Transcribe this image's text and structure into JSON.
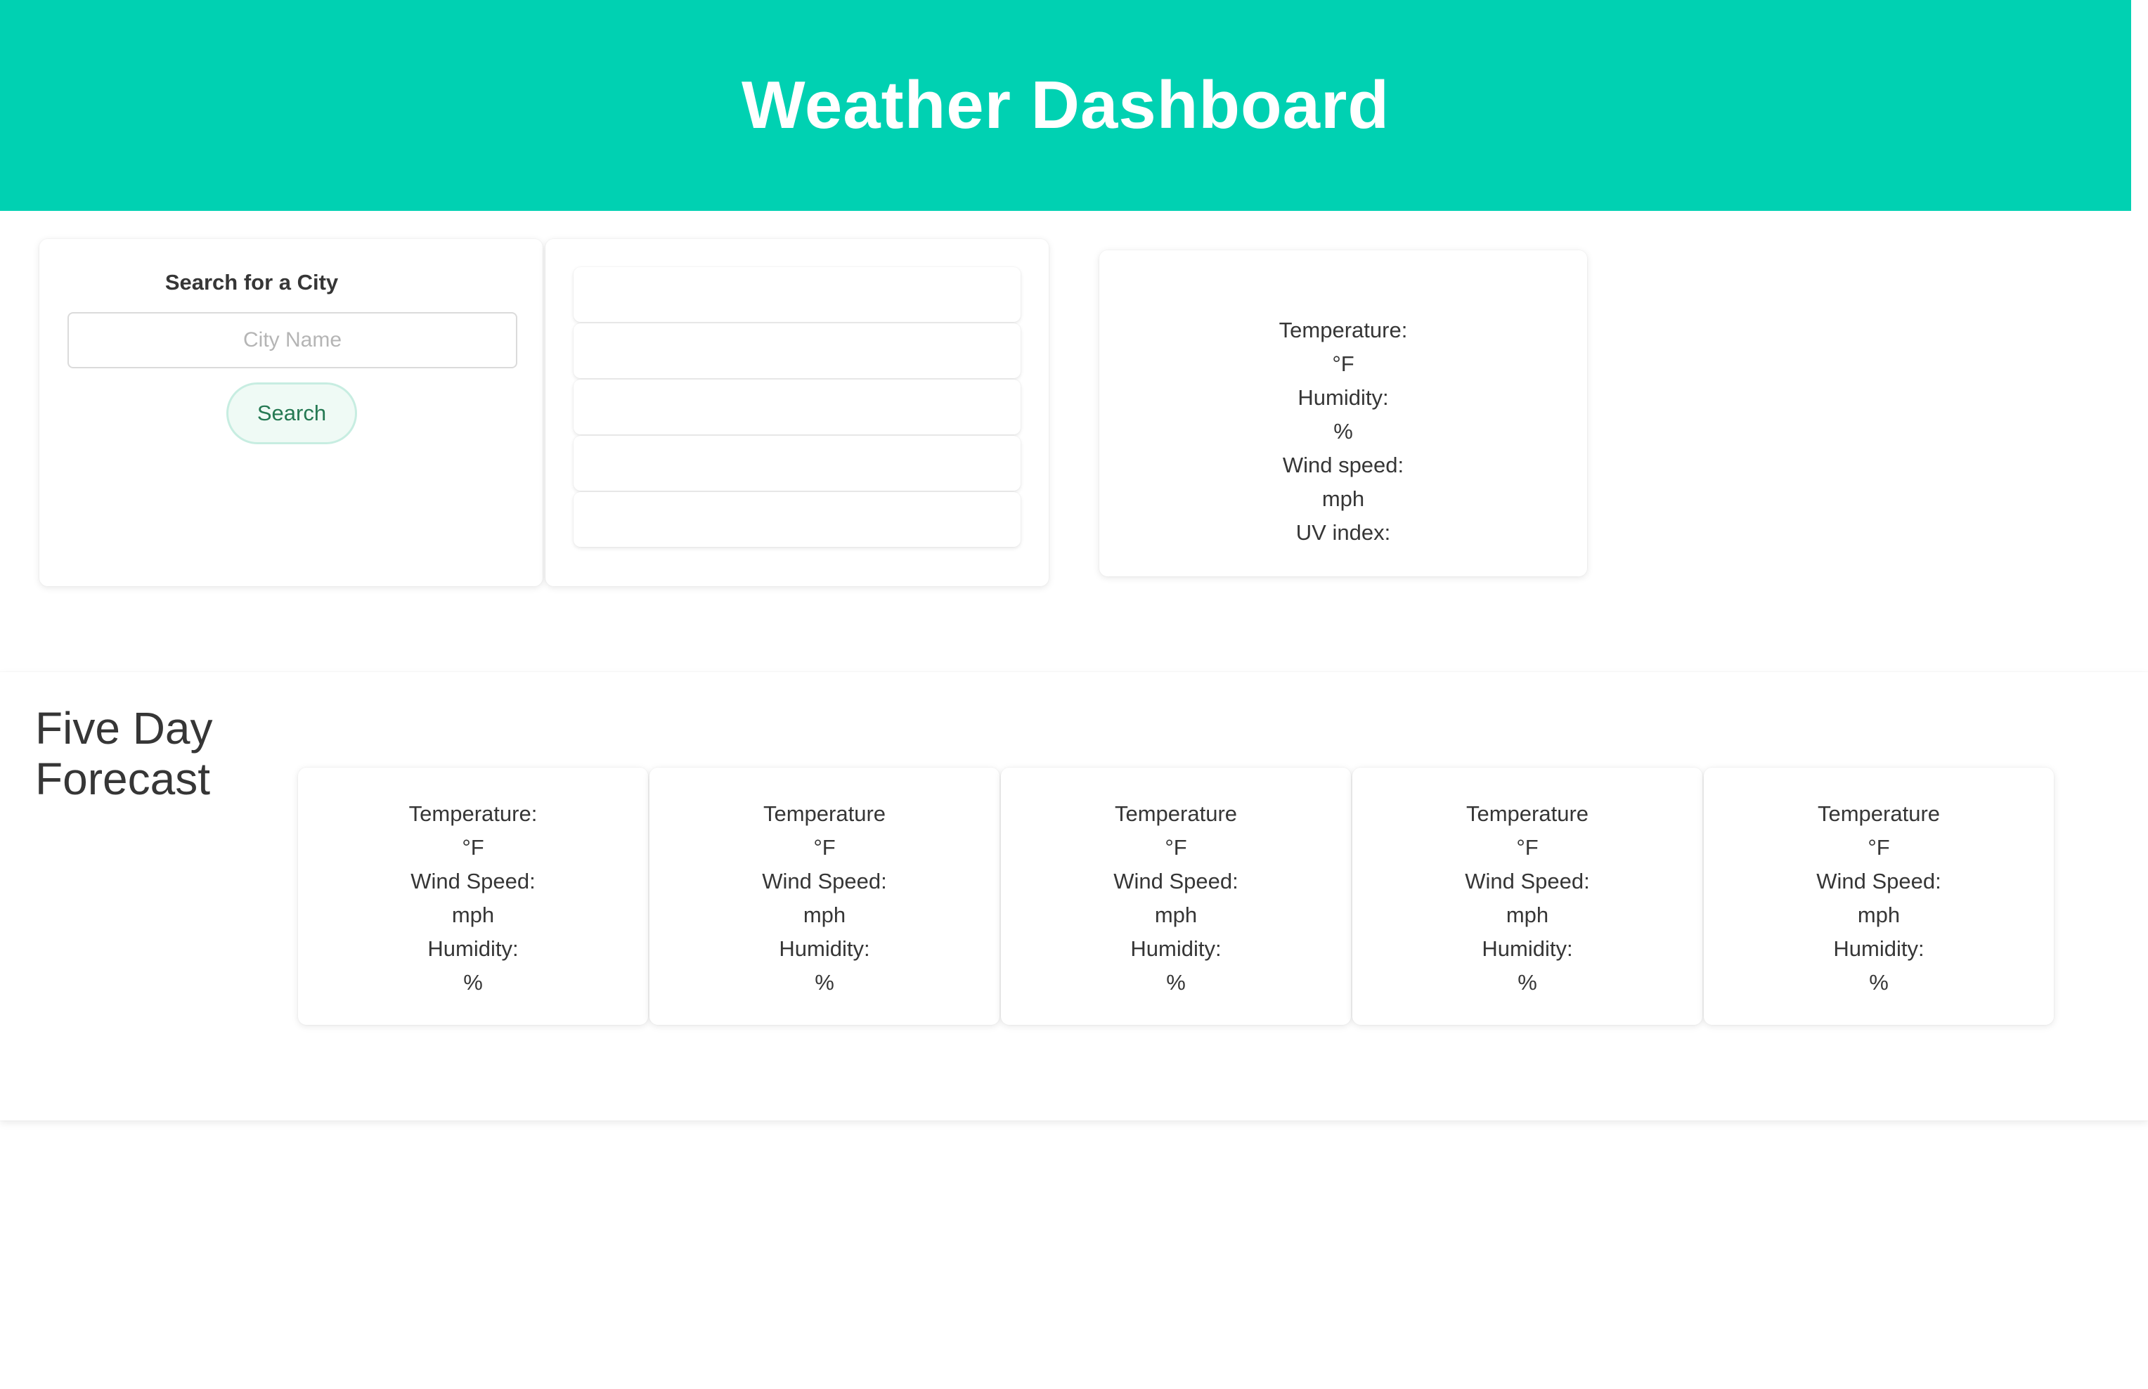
{
  "header": {
    "title": "Weather Dashboard"
  },
  "search": {
    "title": "Search for a City",
    "placeholder": "City Name",
    "value": "",
    "button_label": "Search"
  },
  "history": {
    "items": [
      "",
      "",
      "",
      "",
      ""
    ]
  },
  "current": {
    "temperature_label": "Temperature:",
    "temperature_unit": "°F",
    "humidity_label": "Humidity:",
    "humidity_unit": "%",
    "wind_label": "Wind speed:",
    "wind_unit": "mph",
    "uv_label": "UV index:"
  },
  "forecast": {
    "title": "Five Day Forecast",
    "days": [
      {
        "temperature_label": "Temperature:",
        "temperature_unit": "°F",
        "wind_label": "Wind Speed:",
        "wind_unit": "mph",
        "humidity_label": "Humidity:",
        "humidity_unit": "%"
      },
      {
        "temperature_label": "Temperature",
        "temperature_unit": "°F",
        "wind_label": "Wind Speed:",
        "wind_unit": "mph",
        "humidity_label": "Humidity:",
        "humidity_unit": "%"
      },
      {
        "temperature_label": "Temperature",
        "temperature_unit": "°F",
        "wind_label": "Wind Speed:",
        "wind_unit": "mph",
        "humidity_label": "Humidity:",
        "humidity_unit": "%"
      },
      {
        "temperature_label": "Temperature",
        "temperature_unit": "°F",
        "wind_label": "Wind Speed:",
        "wind_unit": "mph",
        "humidity_label": "Humidity:",
        "humidity_unit": "%"
      },
      {
        "temperature_label": "Temperature",
        "temperature_unit": "°F",
        "wind_label": "Wind Speed:",
        "wind_unit": "mph",
        "humidity_label": "Humidity:",
        "humidity_unit": "%"
      }
    ]
  },
  "colors": {
    "primary": "#00d1b2",
    "button_bg": "#effaf5",
    "button_text": "#257953",
    "text": "#363636"
  }
}
